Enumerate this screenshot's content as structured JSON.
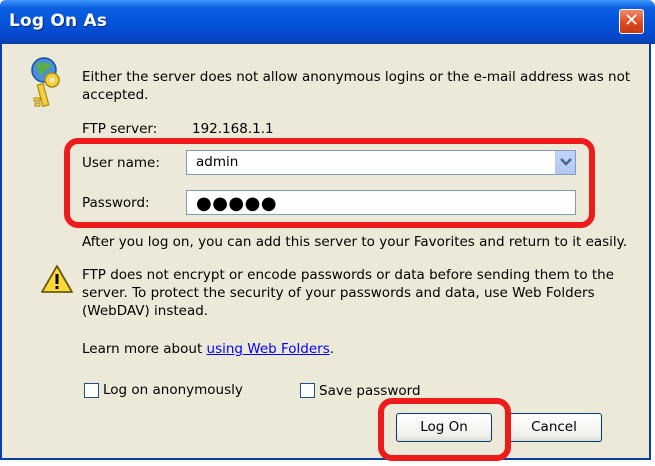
{
  "dialog": {
    "title": "Log On As",
    "message": "Either the server does not allow anonymous logins or the e-mail address was not accepted.",
    "message_line1": "Either the server does not allow anonymous logins or the e-mail address was not",
    "message_line2": "accepted.",
    "ftp_server_label": "FTP server:",
    "ftp_server_value": "192.168.1.1",
    "username_label": "User name:",
    "username_value": "admin",
    "password_label": "Password:",
    "password_value": "●●●●●",
    "favorites_note": "After you log on, you can add this server to your Favorites and return to it easily.",
    "warning_line1": "FTP does not encrypt or encode passwords or data before sending them to the",
    "warning_line2": "server.  To protect the security of your passwords and data, use Web Folders",
    "warning_line3": "(WebDAV) instead.",
    "learn_more_prefix": "Learn more about ",
    "learn_more_link": "using Web Folders",
    "learn_more_suffix": ".",
    "anonymous_label": "Log on anonymously",
    "anonymous_checked": false,
    "save_password_label": "Save password",
    "save_password_checked": false,
    "logon_button": "Log On",
    "cancel_button": "Cancel",
    "close_glyph": "✕"
  },
  "colors": {
    "titlebar": "#0554dc",
    "dialog_bg": "#ece9d8",
    "highlight": "#ee1b1b",
    "link": "#0000ff"
  },
  "icons": {
    "header_icon": "key-icon",
    "warning_icon": "warning-icon",
    "dropdown_icon": "chevron-down-icon",
    "close_icon": "close-icon"
  }
}
